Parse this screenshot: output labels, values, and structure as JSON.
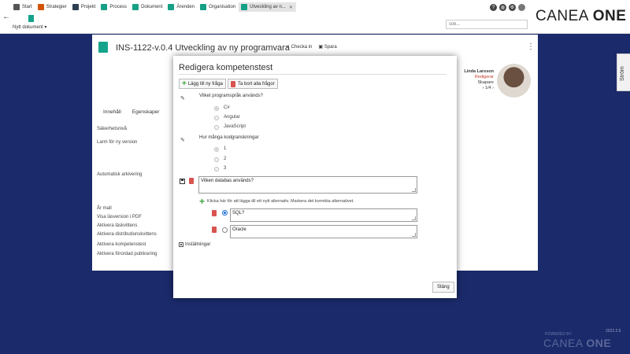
{
  "tabs": [
    {
      "label": "Start",
      "color": "#555555",
      "icon": "home-icon"
    },
    {
      "label": "Strategier",
      "color": "#d35400",
      "icon": "strategy-icon"
    },
    {
      "label": "Projekt",
      "color": "#2c3e50",
      "icon": "project-icon"
    },
    {
      "label": "Process",
      "color": "#16a085",
      "icon": "process-icon"
    },
    {
      "label": "Dokument",
      "color": "#16a085",
      "icon": "document-icon"
    },
    {
      "label": "Ärenden",
      "color": "#16a085",
      "icon": "cases-icon"
    },
    {
      "label": "Organisation",
      "color": "#16a085",
      "icon": "organisation-icon"
    },
    {
      "label": "Utveckling av n...",
      "color": "#16a085",
      "icon": "document-icon",
      "active": true
    }
  ],
  "brand": {
    "prefix": "CANEA",
    "suffix": "ONE"
  },
  "toolbar": {
    "new_document": "Nytt dokument"
  },
  "search": {
    "placeholder": "sök..."
  },
  "document": {
    "title": "INS-1122-v.0.4 Utveckling av ny programvara",
    "check_in": "Checka in",
    "save": "Spara"
  },
  "person": {
    "name": "Linda Larsson",
    "status": "Redigerar",
    "role": "Skapare",
    "pager": "1/4"
  },
  "doc_tabs": [
    "Innehåll",
    "Egenskaper"
  ],
  "fields": [
    "Säkerhetsnivå",
    "Larm för ny version",
    "Automatisk arkivering",
    "År mall",
    "Visa läsversion i PDF",
    "Aktivera läskvittens",
    "Aktivera distributionskvittens",
    "Aktivera kompetenstest",
    "Aktivera förordad publicering"
  ],
  "side_tab": "Ström",
  "footer": {
    "version": "2022.2.6",
    "powered": "POWERED BY",
    "logo_prefix": "CANEA",
    "logo_suffix": "ONE"
  },
  "modal": {
    "title": "Redigera kompetenstest",
    "add_question": "Lägg till ny fråga",
    "delete_all": "Ta bort alla frågor",
    "questions": [
      {
        "text": "Vilket programspråk används?",
        "options": [
          "C#",
          "Angular",
          "JavaScript"
        ],
        "selected": 0
      },
      {
        "text": "Hur många kodgranskningar",
        "options": [
          "1",
          "2",
          "3"
        ],
        "selected": 0
      }
    ],
    "editing": {
      "question": "Vilken databas används?",
      "add_alternative_hint": "Klicka här för att lägga till ett nytt alternativ. Markera det korrekta alternativet.",
      "alternatives": [
        {
          "text": "SQL?",
          "correct": true
        },
        {
          "text": "Oracle",
          "correct": false
        }
      ]
    },
    "settings": "Inställningar",
    "close": "Stäng"
  }
}
